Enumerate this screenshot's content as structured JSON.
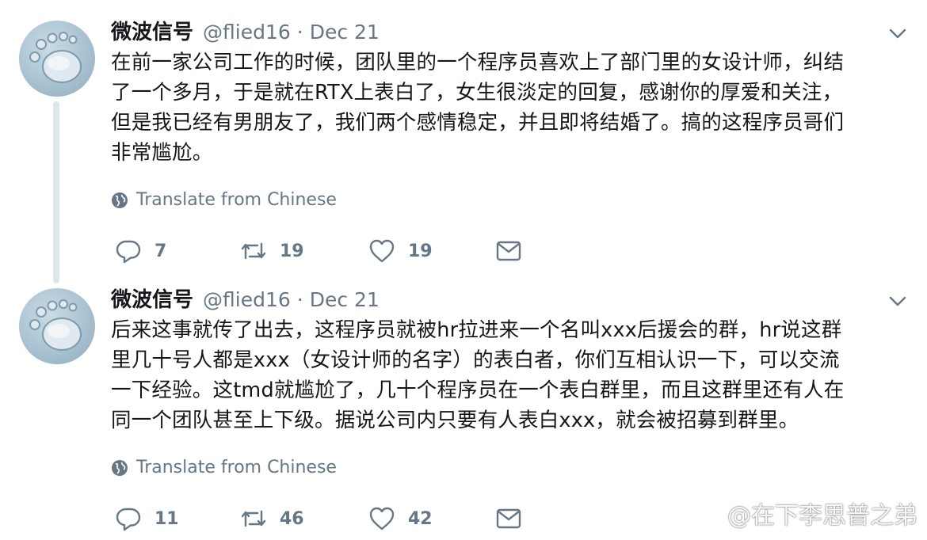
{
  "tweets": [
    {
      "display_name": "微波信号",
      "handle": "@flied16",
      "separator": "·",
      "date": "Dec 21",
      "text_lines": [
        "在前一家公司工作的时候，团队里的一个程序员喜欢上了部门里的女设计师，纠结",
        "了一个多月，于是就在RTX上表白了，女生很淡定的回复，感谢你的厚爱和关注，",
        "但是我已经有男朋友了，我们两个感情稳定，并且即将结婚了。搞的这程序员哥们",
        "非常尴尬。"
      ],
      "translate_label": "Translate from Chinese",
      "replies": "7",
      "retweets": "19",
      "likes": "19"
    },
    {
      "display_name": "微波信号",
      "handle": "@flied16",
      "separator": "·",
      "date": "Dec 21",
      "text_lines": [
        "后来这事就传了出去，这程序员就被hr拉进来一个名叫xxx后援会的群，hr说这群",
        "里几十号人都是xxx（女设计师的名字）的表白者，你们互相认识一下，可以交流",
        "一下经验。这tmd就尴尬了，几十个程序员在一个表白群里，而且这群里还有人在",
        "同一个团队甚至上下级。据说公司内只要有人表白xxx，就会被招募到群里。"
      ],
      "translate_label": "Translate from Chinese",
      "replies": "11",
      "retweets": "46",
      "likes": "42"
    }
  ],
  "watermark": "@在下李思普之弟",
  "colors": {
    "text": "#14171a",
    "muted": "#657786",
    "thread_line": "#dfe6ea",
    "avatar_bg": "#a9c2d1"
  },
  "icons": [
    "avatar-footprint",
    "chevron-down-icon",
    "globe-icon",
    "reply-icon",
    "retweet-icon",
    "like-icon",
    "message-icon",
    "weibo-logo-icon"
  ]
}
